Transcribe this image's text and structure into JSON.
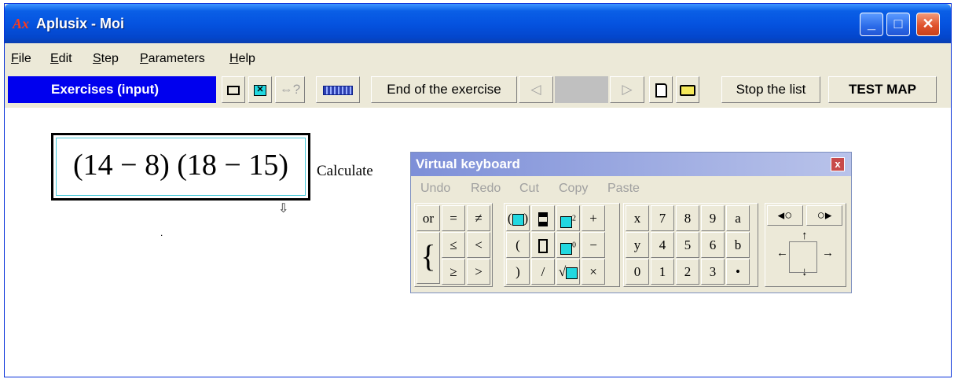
{
  "window": {
    "logo": "Ax",
    "title": "Aplusix - Moi",
    "controls": {
      "minimize": "_",
      "maximize": "□",
      "close": "✕"
    }
  },
  "menu": [
    {
      "first": "F",
      "rest": "ile"
    },
    {
      "first": "E",
      "rest": "dit"
    },
    {
      "first": "S",
      "rest": "tep"
    },
    {
      "first": "P",
      "rest": "arameters"
    },
    {
      "first": "H",
      "rest": "elp"
    }
  ],
  "toolbar": {
    "mode": "Exercises (input)",
    "end_exercise": "End of the exercise",
    "prev_glyph": "◁",
    "next_glyph": "▷",
    "stop_list": "Stop the list",
    "test_map": "TEST MAP",
    "hint_glyph": "⇔?",
    "icons": [
      "rectangle-icon",
      "cancel-icon",
      "equivalence-icon",
      "keyboard-icon",
      "new-document-icon",
      "open-folder-icon"
    ]
  },
  "expression": {
    "text": "(14 − 8)  (18 − 15)",
    "instruction": "Calculate",
    "handle": "⇩",
    "dot": "."
  },
  "virtual_keyboard": {
    "title": "Virtual keyboard",
    "close": "x",
    "menu": [
      "Undo",
      "Redo",
      "Cut",
      "Copy",
      "Paste"
    ],
    "relations": [
      "or",
      "=",
      "≠",
      "≤",
      "<",
      "≥",
      ">"
    ],
    "brace": "{",
    "operators": [
      "+",
      "−",
      "×",
      "/",
      "(",
      ")"
    ],
    "numpad": [
      "x",
      "7",
      "8",
      "9",
      "a",
      "y",
      "4",
      "5",
      "6",
      "b",
      "0",
      "1",
      "2",
      "3",
      "•"
    ],
    "nav": [
      "↑",
      "←",
      "→",
      "↓"
    ]
  }
}
